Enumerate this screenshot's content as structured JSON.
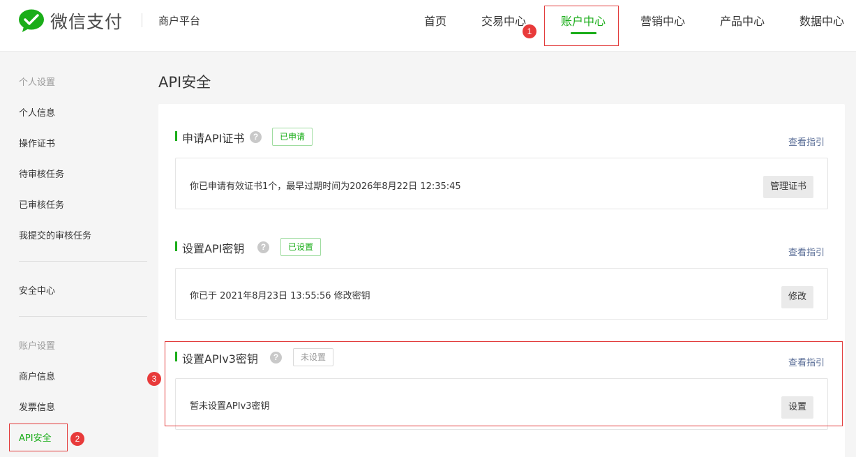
{
  "header": {
    "brand": "微信支付",
    "platform": "商户平台",
    "nav": [
      {
        "label": "首页",
        "active": false
      },
      {
        "label": "交易中心",
        "active": false
      },
      {
        "label": "账户中心",
        "active": true
      },
      {
        "label": "营销中心",
        "active": false
      },
      {
        "label": "产品中心",
        "active": false
      },
      {
        "label": "数据中心",
        "active": false
      }
    ]
  },
  "markers": [
    "1",
    "2",
    "3"
  ],
  "sidebar": {
    "group1": "个人设置",
    "items1": [
      "个人信息",
      "操作证书",
      "待审核任务",
      "已审核任务",
      "我提交的审核任务"
    ],
    "security": "安全中心",
    "group2": "账户设置",
    "items2": [
      "商户信息",
      "发票信息",
      "API安全"
    ]
  },
  "main": {
    "title": "API安全",
    "sections": [
      {
        "title": "申请API证书",
        "help": "?",
        "tag": "已申请",
        "guide": "查看指引",
        "text": "你已申请有效证书1个，最早过期时间为2026年8月22日 12:35:45",
        "button": "管理证书"
      },
      {
        "title": "设置API密钥",
        "help": "?",
        "tag": "已设置",
        "guide": "查看指引",
        "text": "你已于 2021年8月23日 13:55:56 修改密钥",
        "button": "修改"
      },
      {
        "title": "设置APIv3密钥",
        "help": "?",
        "tag": "未设置",
        "guide": "查看指引",
        "text": "暂未设置APIv3密钥",
        "button": "设置"
      }
    ]
  },
  "colors": {
    "brand_green": "#1aad19",
    "link_blue": "#576b95",
    "annotation_red": "#e23c3c"
  }
}
